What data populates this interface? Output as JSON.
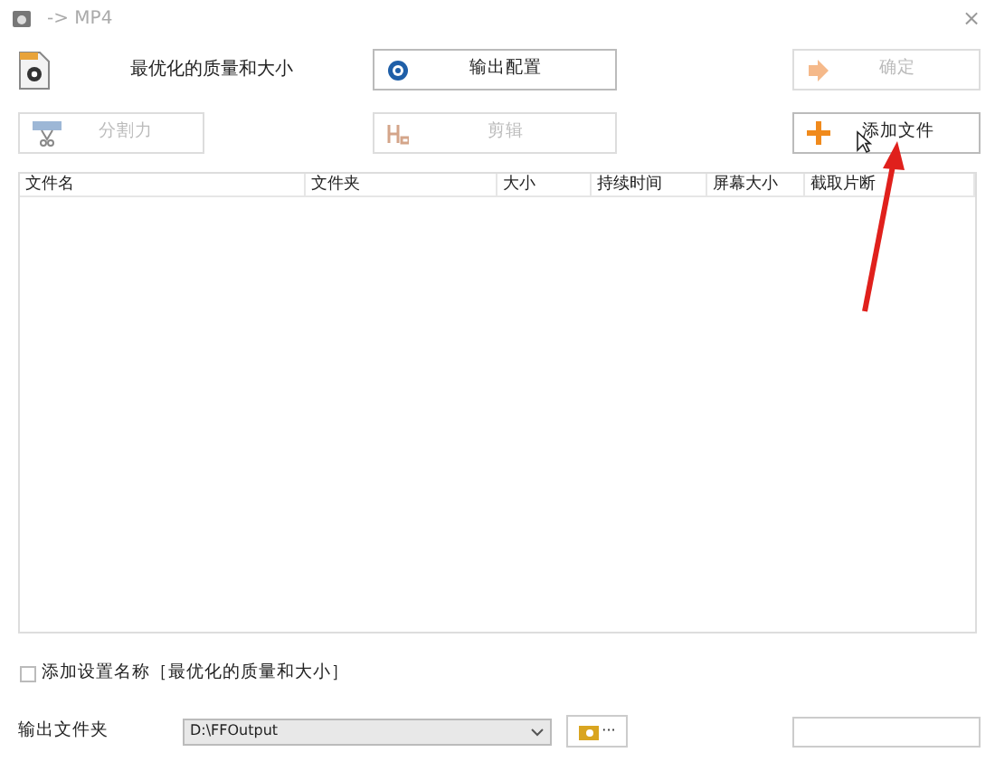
{
  "window": {
    "title": "-> MP4",
    "close": "×"
  },
  "preset": {
    "label": "最优化的质量和大小"
  },
  "buttons": [
    {
      "label": "输出配置",
      "disabled": false,
      "kind": "config"
    },
    {
      "label": "确定",
      "disabled": true,
      "kind": "ok"
    },
    {
      "label": "分割力",
      "disabled": true,
      "kind": "split"
    },
    {
      "label": "剪辑",
      "disabled": true,
      "kind": "clip"
    },
    {
      "label": "添加文件",
      "disabled": false,
      "kind": "add"
    }
  ],
  "table": {
    "columns": [
      "文件名",
      "文件夹",
      "大小",
      "持续时间",
      "屏幕大小",
      "截取片断"
    ]
  },
  "add_setting_name": {
    "label": "添加设置名称［最优化的质量和大小］",
    "checked": false
  },
  "output_folder": {
    "label": "输出文件夹",
    "value": "D:\\FFOutput",
    "browse": "···"
  }
}
